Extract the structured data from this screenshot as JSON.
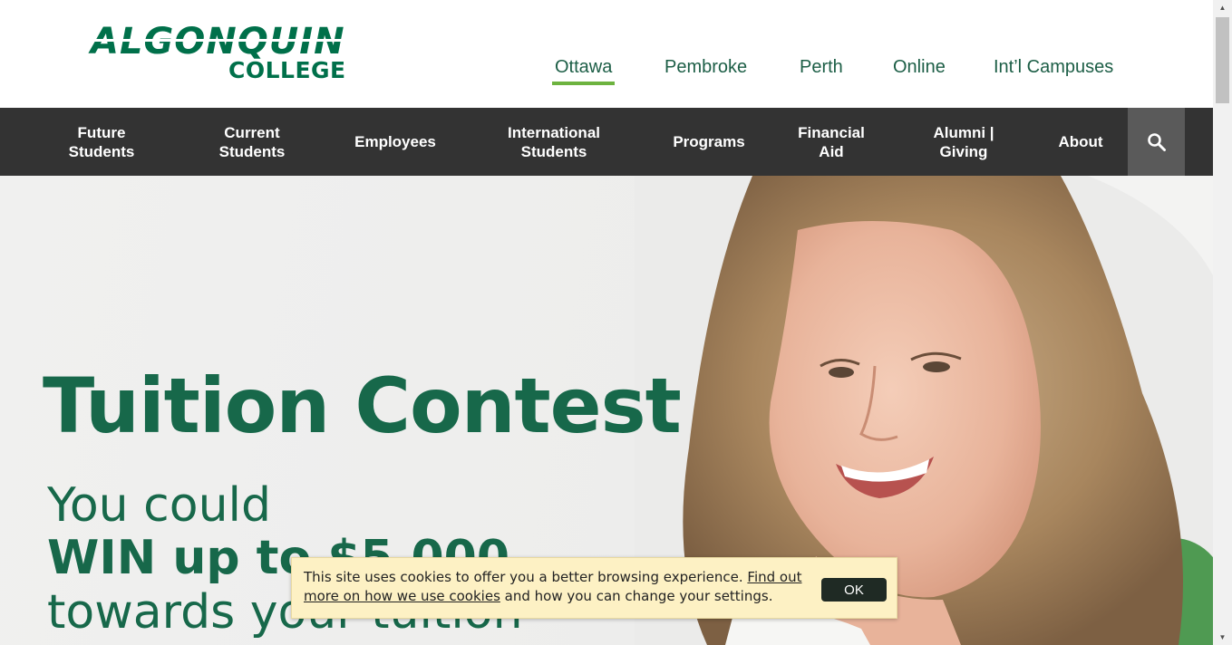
{
  "logo": {
    "line1": "ALGONQUIN",
    "line2": "COLLEGE"
  },
  "campus_nav": [
    {
      "label": "Ottawa",
      "active": true
    },
    {
      "label": "Pembroke",
      "active": false
    },
    {
      "label": "Perth",
      "active": false
    },
    {
      "label": "Online",
      "active": false
    },
    {
      "label": "Int’l Campuses",
      "active": false
    }
  ],
  "main_nav": [
    {
      "line1": "Future",
      "line2": "Students"
    },
    {
      "line1": "Current",
      "line2": "Students"
    },
    {
      "line1": "Employees",
      "line2": ""
    },
    {
      "line1": "International",
      "line2": "Students"
    },
    {
      "line1": "Programs",
      "line2": ""
    },
    {
      "line1": "Financial",
      "line2": "Aid"
    },
    {
      "line1": "Alumni |",
      "line2": "Giving"
    },
    {
      "line1": "About",
      "line2": ""
    }
  ],
  "search": {
    "icon": "search-icon"
  },
  "hero": {
    "title": "Tuition Contest",
    "line1": "You could",
    "line2": "WIN up to $5,000",
    "line3": "towards your tuition"
  },
  "cookie": {
    "text_before": "This site uses cookies to offer you a better browsing experience. ",
    "link_text": "Find out more on how we use cookies",
    "text_after": " and how you can change your settings.",
    "ok_label": "OK"
  },
  "colors": {
    "brand_green": "#00704a",
    "nav_bg": "#333333",
    "active_underline": "#6db33f",
    "cookie_bg": "#fdf1c4"
  }
}
